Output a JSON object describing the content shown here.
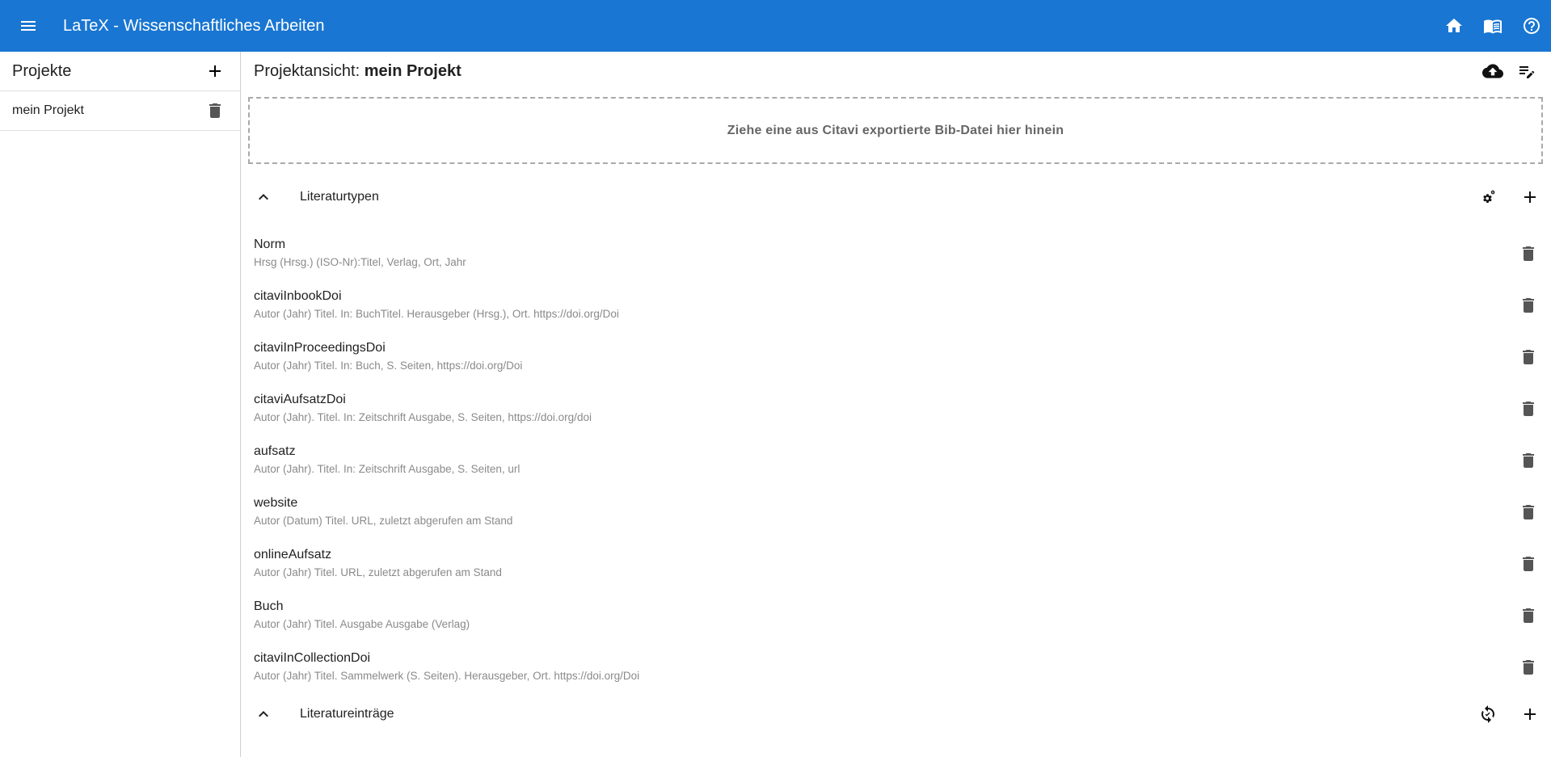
{
  "appbar": {
    "title": "LaTeX - Wissenschaftliches Arbeiten",
    "icons": [
      "menu-icon",
      "home-icon",
      "book-icon",
      "help-icon"
    ],
    "color": "#1976d2"
  },
  "sidebar": {
    "heading": "Projekte",
    "items": [
      {
        "label": "mein Projekt"
      }
    ]
  },
  "main": {
    "title_prefix": "Projektansicht: ",
    "project_name": "mein Projekt",
    "dropzone_text": "Ziehe eine aus Citavi exportierte Bib-Datei hier hinein",
    "sections": {
      "types": {
        "title": "Literaturtypen",
        "expanded": true
      },
      "entries": {
        "title": "Literatureinträge",
        "expanded": true
      }
    },
    "literature_types": [
      {
        "name": "Norm",
        "format": "Hrsg (Hrsg.) (ISO-Nr):Titel, Verlag, Ort, Jahr"
      },
      {
        "name": "citaviInbookDoi",
        "format": "Autor (Jahr) Titel. In: BuchTitel. Herausgeber (Hrsg.), Ort. https://doi.org/Doi"
      },
      {
        "name": "citaviInProceedingsDoi",
        "format": "Autor (Jahr) Titel. In: Buch, S. Seiten, https://doi.org/Doi"
      },
      {
        "name": "citaviAufsatzDoi",
        "format": "Autor (Jahr). Titel. In: Zeitschrift Ausgabe, S. Seiten, https://doi.org/doi"
      },
      {
        "name": "aufsatz",
        "format": "Autor (Jahr). Titel. In: Zeitschrift Ausgabe, S. Seiten, url"
      },
      {
        "name": "website",
        "format": "Autor (Datum) Titel. URL, zuletzt abgerufen am Stand"
      },
      {
        "name": "onlineAufsatz",
        "format": "Autor (Jahr) Titel. URL, zuletzt abgerufen am Stand"
      },
      {
        "name": "Buch",
        "format": "Autor (Jahr) Titel. Ausgabe Ausgabe (Verlag)"
      },
      {
        "name": "citaviInCollectionDoi",
        "format": "Autor (Jahr) Titel. Sammelwerk (S. Seiten). Herausgeber, Ort. https://doi.org/Doi"
      }
    ]
  }
}
